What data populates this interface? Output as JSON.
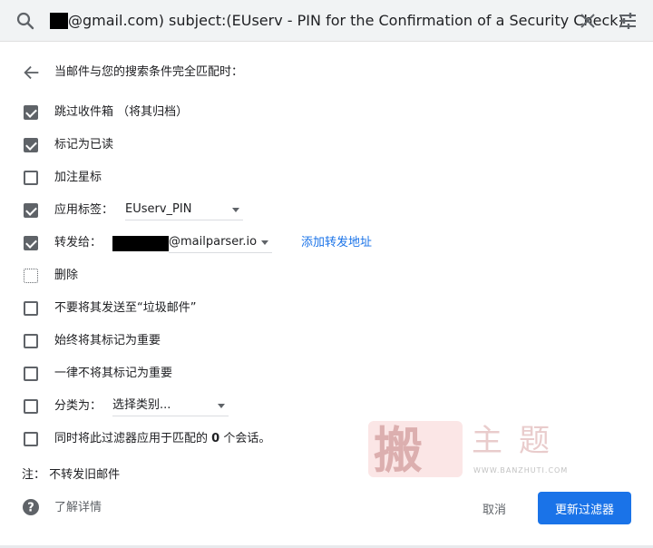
{
  "search": {
    "query": "@gmail.com) subject:(EUserv - PIN for the Confirmation of a Security Check)",
    "search_icon": "search-icon",
    "close_icon": "close-icon",
    "options_icon": "tune-icon"
  },
  "header": {
    "back_icon": "arrow-back-icon",
    "text": "当邮件与您的搜索条件完全匹配时："
  },
  "actions": [
    {
      "label": "跳过收件箱 （将其归档）",
      "checked": true
    },
    {
      "label": "标记为已读",
      "checked": true
    },
    {
      "label": "加注星标",
      "checked": false
    },
    {
      "label": "应用标签：",
      "checked": true,
      "dropdown_value": "EUserv_PIN"
    },
    {
      "label": "转发给：",
      "checked": true,
      "dropdown_value": "@mailparser.io",
      "link": "添加转发地址"
    },
    {
      "label": "删除",
      "checked": false
    },
    {
      "label": "不要将其发送至“垃圾邮件”",
      "checked": false
    },
    {
      "label": "始终将其标记为重要",
      "checked": false
    },
    {
      "label": "一律不将其标记为重要",
      "checked": false
    },
    {
      "label": "分类为：",
      "checked": false,
      "dropdown_value": "选择类别..."
    }
  ],
  "apply_existing": {
    "prefix": "同时将此过滤器应用于匹配的 ",
    "count": "0",
    "suffix": " 个会话。",
    "checked": false
  },
  "note": "注：  不转发旧邮件",
  "footer": {
    "help_icon": "help-icon",
    "help_text": "了解详情",
    "cancel_label": "取消",
    "update_label": "更新过滤器"
  },
  "watermark": {
    "seal_char": "搬",
    "title": "主题",
    "url": "WWW.BANZHUTI.COM"
  },
  "colors": {
    "accent": "#1a73e8",
    "checkbox": "#5f6368",
    "searchbar_bg": "#f1f3f4"
  }
}
